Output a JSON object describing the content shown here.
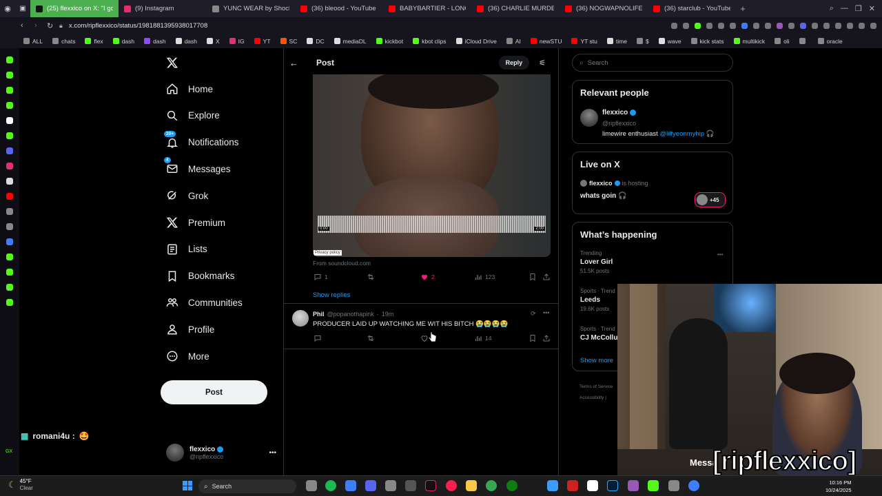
{
  "browser": {
    "tabs": [
      {
        "label": "(25) flexxico on X: \"I got",
        "color": "#4caf50",
        "active": true
      },
      {
        "label": "(9) Instagram",
        "color": "#e1306c"
      },
      {
        "label": "YUNC WEAR by Shockak",
        "color": "#888888"
      },
      {
        "label": "(36) bleood - YouTube",
        "color": "#ff0000"
      },
      {
        "label": "BABYBARTIER - LONG TI",
        "color": "#ff0000"
      },
      {
        "label": "(36) CHARLIE MURDER -",
        "color": "#ff0000"
      },
      {
        "label": "(36) NOGWAPNOLIFE - Y",
        "color": "#ff0000"
      },
      {
        "label": "(36) starclub - YouTube",
        "color": "#ff0000"
      }
    ],
    "url": "x.com/ripflexxico/status/1981881395938017708",
    "bookmarks": [
      {
        "label": "ALL",
        "color": "#888888"
      },
      {
        "label": "chats",
        "color": "#888888"
      },
      {
        "label": "flex",
        "color": "#53fc18"
      },
      {
        "label": "dash",
        "color": "#53fc18"
      },
      {
        "label": "dash",
        "color": "#9146ff"
      },
      {
        "label": "dash",
        "color": "#dddddd"
      },
      {
        "label": "X",
        "color": "#dddddd"
      },
      {
        "label": "IG",
        "color": "#e1306c"
      },
      {
        "label": "YT",
        "color": "#ff0000"
      },
      {
        "label": "SC",
        "color": "#ff5500"
      },
      {
        "label": "DC",
        "color": "#dddddd"
      },
      {
        "label": "mediaDL",
        "color": "#dddddd"
      },
      {
        "label": "kickbot",
        "color": "#53fc18"
      },
      {
        "label": "kbot clips",
        "color": "#53fc18"
      },
      {
        "label": "iCloud Drive",
        "color": "#dddddd"
      },
      {
        "label": "AI",
        "color": "#888888"
      },
      {
        "label": "newSTU",
        "color": "#ff0000"
      },
      {
        "label": "YT stu",
        "color": "#ff0000"
      },
      {
        "label": "time",
        "color": "#dddddd"
      },
      {
        "label": "$",
        "color": "#888888"
      },
      {
        "label": "wave",
        "color": "#dddddd"
      },
      {
        "label": "kick stats",
        "color": "#888888"
      },
      {
        "label": "multikick",
        "color": "#53fc18"
      },
      {
        "label": "oli",
        "color": "#888888"
      },
      {
        "label": "",
        "color": "#888888"
      },
      {
        "label": "oracle",
        "color": "#888888"
      }
    ]
  },
  "nav": {
    "items": [
      {
        "label": "Home",
        "icon": "home-icon"
      },
      {
        "label": "Explore",
        "icon": "search-icon"
      },
      {
        "label": "Notifications",
        "icon": "bell-icon",
        "badge": "20+"
      },
      {
        "label": "Messages",
        "icon": "mail-icon",
        "badge": "4"
      },
      {
        "label": "Grok",
        "icon": "grok-icon"
      },
      {
        "label": "Premium",
        "icon": "x-logo-icon"
      },
      {
        "label": "Lists",
        "icon": "list-icon"
      },
      {
        "label": "Bookmarks",
        "icon": "bookmark-icon"
      },
      {
        "label": "Communities",
        "icon": "people-icon"
      },
      {
        "label": "Profile",
        "icon": "person-icon"
      },
      {
        "label": "More",
        "icon": "more-circle-icon"
      }
    ],
    "post_label": "Post",
    "account": {
      "name": "flexxico",
      "handle": "@ripflexxico"
    }
  },
  "chat_overlay": {
    "user": "romani4u :",
    "emoji": "🤩"
  },
  "main": {
    "header_title": "Post",
    "reply_label": "Reply",
    "audio": {
      "start": "0:00",
      "end": "2:00",
      "privacy": "Privacy policy"
    },
    "source": "From soundcloud.com",
    "stats": {
      "replies": "1",
      "likes": "2",
      "views": "123"
    },
    "show_replies": "Show replies",
    "reply": {
      "name": "Phil",
      "handle": "@popanothapink",
      "time": "19m",
      "text": "PRODUCER LAID UP WATCHING ME WIT HIS BITCH 😭😭😭😭",
      "views": "14"
    }
  },
  "sidebar": {
    "search_placeholder": "Search",
    "relevant": {
      "title": "Relevant people",
      "name": "flexxico",
      "handle": "@ripflexxico",
      "bio_text": "limewire enthusiast",
      "bio_link": "@lilfyeonmyhip",
      "bio_emoji": "🎧"
    },
    "live": {
      "title": "Live on X",
      "host": "flexxico",
      "hosting": "is hosting",
      "topic": "whats goin 🎧",
      "count": "+45"
    },
    "happening": {
      "title": "What’s happening",
      "trends": [
        {
          "category": "Trending",
          "name": "Lover Girl",
          "posts": "51.5K posts"
        },
        {
          "category": "Sports · Trend",
          "name": "Leeds",
          "posts": "19.6K posts"
        },
        {
          "category": "Sports · Trend",
          "name": "CJ McCollu",
          "posts": ""
        }
      ],
      "show_more": "Show more"
    },
    "footer": [
      "Terms of Service",
      "Accessibility"
    ]
  },
  "webcam": {
    "overlay_text": "[ripflexxico]",
    "behind_text": "Messa"
  },
  "taskbar": {
    "weather_temp": "45°F",
    "weather_desc": "Clear",
    "search_label": "Search",
    "time": "10:16 PM",
    "date": "10/24/2025"
  }
}
